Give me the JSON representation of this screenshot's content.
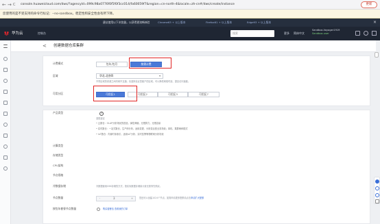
{
  "browser": {
    "back": "←",
    "forward": "→",
    "reload": "C",
    "url": "console.huaweicloud.com/dws/?agencyId=099c98a0776f0f5f0f3cc014/fa60059f7&region=cn-north-4&locale=zh-cn#/dws/create/instance",
    "update_label": "更新"
  },
  "warning": "您使用的是不受支持的命令行标记：--no-sandbox。稳定性和安全性会有所下降。",
  "notice": {
    "text": "建议使用以下浏览器，以获得更流畅体验",
    "chrome": "Chrome63 + 以上版本",
    "firefox": "Firefox61 + 以上版本",
    "edge": "Edge93 + 以上版本",
    "close": "×"
  },
  "topnav": {
    "brand": "华为云",
    "console": "控制台",
    "search_placeholder": "搜索",
    "more": "更多",
    "simple": "简体中文",
    "account_name": "Sandbox-Voyager1919",
    "account_sub": "Sandbox-user"
  },
  "page": {
    "back": "<",
    "title": "创建数据仓库集群"
  },
  "billing": {
    "label": "计费模式",
    "options": [
      "包年/包月",
      "按需计费"
    ],
    "selected": "按需计费"
  },
  "region": {
    "label": "区域",
    "value": "华北-北京四",
    "hint": "不同区域的资源之间内网不互通。请选择靠近您客户的区域，可以降低网络时延、提高访问速度。"
  },
  "az": {
    "label": "可用分区",
    "options": [
      "可用区1",
      "可用区2",
      "可用区3",
      "可用区7"
    ],
    "selected": "可用区1"
  },
  "product": {
    "label": "产品类型",
    "question": "?",
    "hint_title": "选型建议",
    "bullets": [
      "• 云数仓：OLAP分析场景的首选，弹性伸缩，无限算力，无限容量",
      "• 实时数仓：一站式数仓，生产即分析，适用变更、分析混合型业务场景；单机、集群两种模式",
      "• IoT数仓：内置时序索引，适用IoT分析、实时告警等物联网分析场景"
    ]
  },
  "fields": {
    "compute": "计算类型",
    "storage": "存储类型",
    "cpu": "CPU架构",
    "node_flavor": "节点规格",
    "hot_storage": "冷数据存储",
    "hot_hint": "冷数据使用OBS存储的方式，按实际数据存储量计费无需事先购买。",
    "node_count": "节点数量",
    "node_hint_pre": "您还可以创建1024个节点，如需申请更多配额请点击",
    "node_hint_link": "申请扩大配额",
    "stepper_value": "3",
    "minus": "-",
    "plus": "+",
    "ondemand_nodes": "按包年套餐节点数量",
    "ondemand_links": "购买套餐包    查看我的订单"
  }
}
